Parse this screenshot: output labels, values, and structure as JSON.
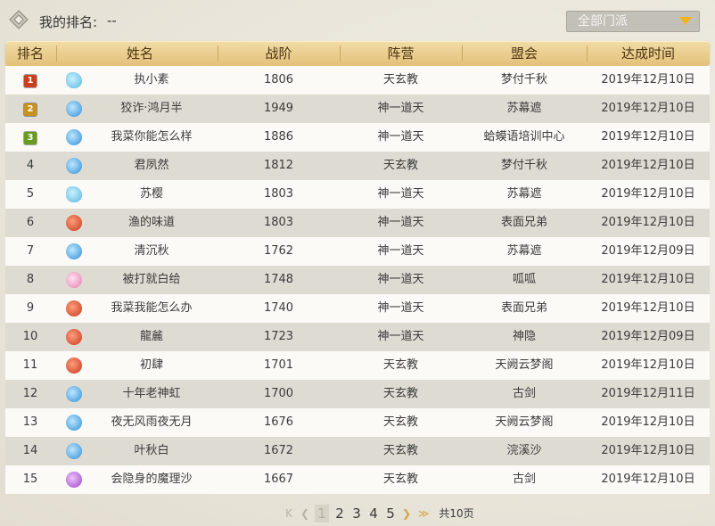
{
  "top": {
    "my_rank_label": "我的排名:",
    "my_rank_value": "--",
    "faction_select": "全部门派"
  },
  "columns": [
    "排名",
    "姓名",
    "战阶",
    "阵营",
    "盟会",
    "达成时间"
  ],
  "rows": [
    {
      "rank": "1",
      "name": "执小素",
      "power": "1806",
      "camp": "天玄教",
      "guild": "梦付千秋",
      "date": "2019年12月10日",
      "icon": "teal"
    },
    {
      "rank": "2",
      "name": "狡诈·鸿月半",
      "power": "1949",
      "camp": "神一道天",
      "guild": "苏幕遮",
      "date": "2019年12月10日",
      "icon": "blue"
    },
    {
      "rank": "3",
      "name": "我菜你能怎么样",
      "power": "1886",
      "camp": "神一道天",
      "guild": "蛤蟆语培训中心",
      "date": "2019年12月10日",
      "icon": "blue"
    },
    {
      "rank": "4",
      "name": "君夙然",
      "power": "1812",
      "camp": "天玄教",
      "guild": "梦付千秋",
      "date": "2019年12月10日",
      "icon": "blue"
    },
    {
      "rank": "5",
      "name": "苏樱",
      "power": "1803",
      "camp": "神一道天",
      "guild": "苏幕遮",
      "date": "2019年12月10日",
      "icon": "teal"
    },
    {
      "rank": "6",
      "name": "渔的味道",
      "power": "1803",
      "camp": "神一道天",
      "guild": "表面兄弟",
      "date": "2019年12月10日",
      "icon": "red"
    },
    {
      "rank": "7",
      "name": "清沉秋",
      "power": "1762",
      "camp": "神一道天",
      "guild": "苏幕遮",
      "date": "2019年12月09日",
      "icon": "blue"
    },
    {
      "rank": "8",
      "name": "被打就白给",
      "power": "1748",
      "camp": "神一道天",
      "guild": "呱呱",
      "date": "2019年12月10日",
      "icon": "pink"
    },
    {
      "rank": "9",
      "name": "我菜我能怎么办",
      "power": "1740",
      "camp": "神一道天",
      "guild": "表面兄弟",
      "date": "2019年12月10日",
      "icon": "red"
    },
    {
      "rank": "10",
      "name": "龍麄",
      "power": "1723",
      "camp": "神一道天",
      "guild": "神隐",
      "date": "2019年12月09日",
      "icon": "red"
    },
    {
      "rank": "11",
      "name": "初肆",
      "power": "1701",
      "camp": "天玄教",
      "guild": "天阙云梦阁",
      "date": "2019年12月10日",
      "icon": "red"
    },
    {
      "rank": "12",
      "name": "十年老神虹",
      "power": "1700",
      "camp": "天玄教",
      "guild": "古剑",
      "date": "2019年12月11日",
      "icon": "blue"
    },
    {
      "rank": "13",
      "name": "夜无风雨夜无月",
      "power": "1676",
      "camp": "天玄教",
      "guild": "天阙云梦阁",
      "date": "2019年12月10日",
      "icon": "blue"
    },
    {
      "rank": "14",
      "name": "叶秋白",
      "power": "1672",
      "camp": "天玄教",
      "guild": "浣溪沙",
      "date": "2019年12月10日",
      "icon": "blue"
    },
    {
      "rank": "15",
      "name": "会隐身的魔理沙",
      "power": "1667",
      "camp": "天玄教",
      "guild": "古剑",
      "date": "2019年12月10日",
      "icon": "purple"
    }
  ],
  "pager": {
    "first_icon": "K",
    "prev_icon": "❮",
    "pages": [
      "1",
      "2",
      "3",
      "4",
      "5"
    ],
    "current": "1",
    "next_icon": "❯",
    "last_icon": "≫",
    "total": "共10页"
  }
}
